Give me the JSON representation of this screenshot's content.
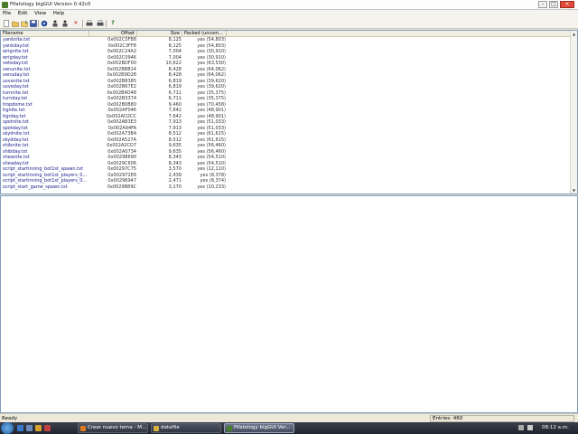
{
  "window": {
    "title": "Fifatology bigGUI Version 0.42c0",
    "title_buttons": {
      "minimize": "–",
      "maximize": "□",
      "close": "×"
    }
  },
  "menu": [
    "File",
    "Edit",
    "View",
    "Help"
  ],
  "toolbar": {
    "icons": [
      "new-icon",
      "open-icon",
      "open-folder-icon",
      "save-icon",
      "disc-icon",
      "import-icon",
      "export-icon",
      "delete-icon",
      "print-icon",
      "print-setup-icon",
      "help-icon"
    ],
    "help_glyph": "?",
    "delete_glyph": "✕"
  },
  "table": {
    "columns": [
      "Filename",
      "Offset",
      "Size",
      "Packed (uncom..."
    ],
    "rows": [
      [
        "yanknite.txt",
        "0x002C5FB8",
        "8,125",
        "yes (54,803)"
      ],
      [
        "yankday.txt",
        "0x002C3FF8",
        "8,125",
        "yes (54,803)"
      ],
      [
        "wrignite.txt",
        "0x002C24A2",
        "7,004",
        "yes (30,910)"
      ],
      [
        "wrigday.txt",
        "0x002C0946",
        "7,004",
        "yes (30,910)"
      ],
      [
        "veteday.txt",
        "0x002BDF00",
        "10,622",
        "yes (63,530)"
      ],
      [
        "venunite.txt",
        "0x002BBB14",
        "8,428",
        "yes (64,062)"
      ],
      [
        "venuday.txt",
        "0x002B9D28",
        "8,428",
        "yes (64,062)"
      ],
      [
        "usvanite.txt",
        "0x002B8385",
        "6,819",
        "yes (39,620)"
      ],
      [
        "usveday.txt",
        "0x002B67E2",
        "6,819",
        "yes (39,620)"
      ],
      [
        "turnnite.txt",
        "0x002B4D48",
        "6,711",
        "yes (35,375)"
      ],
      [
        "turnday.txt",
        "0x002B3374",
        "6,711",
        "yes (35,375)"
      ],
      [
        "tropdome.txt",
        "0x002B0B80",
        "9,460",
        "yes (70,458)"
      ],
      [
        "tignite.txt",
        "0x002AF046",
        "7,642",
        "yes (48,901)"
      ],
      [
        "tigrday.txt",
        "0x002AD2CC",
        "7,642",
        "yes (48,901)"
      ],
      [
        "spotnite.txt",
        "0x002AB3E3",
        "7,913",
        "yes (51,033)"
      ],
      [
        "spotday.txt",
        "0x002A94FA",
        "7,913",
        "yes (51,033)"
      ],
      [
        "skydnite.txt",
        "0x002A73B4",
        "8,512",
        "yes (61,615)"
      ],
      [
        "skydday.txt",
        "0x002A527A",
        "8,512",
        "yes (61,615)"
      ],
      [
        "shibnite.txt",
        "0x002A2CD7",
        "9,635",
        "yes (56,460)"
      ],
      [
        "shibday.txt",
        "0x002A0734",
        "9,635",
        "yes (56,460)"
      ],
      [
        "sheanite.txt",
        "0x00298690",
        "8,343",
        "yes (54,510)"
      ],
      [
        "sheaday.txt",
        "0x0029C606",
        "8,343",
        "yes (54,510)"
      ],
      [
        "script_startinning_bot1st_spawn.txt",
        "0x00297C75",
        "3,570",
        "yes (12,110)"
      ],
      [
        "script_startinning_bot1st_players_0...",
        "0x002972E8",
        "2,439",
        "yes (8,378)"
      ],
      [
        "script_startinning_bot1st_players_0...",
        "0x00296947",
        "2,471",
        "yes (8,374)"
      ],
      [
        "script_start_game_spawn.txt",
        "0x0029B89C",
        "3,170",
        "yes (10,233)"
      ]
    ]
  },
  "status": {
    "left": "Ready",
    "entries": "Entries: 460"
  },
  "taskbar": {
    "tasks": [
      "Crear nuevo tema - M...",
      "datafile",
      "Fifatology bigGUI Ver..."
    ],
    "clock": "08:12 a.m."
  },
  "colors": {
    "accent": "#1a1a8c",
    "taskbar": "#2a2f3a",
    "close_button": "#e04a3a"
  }
}
